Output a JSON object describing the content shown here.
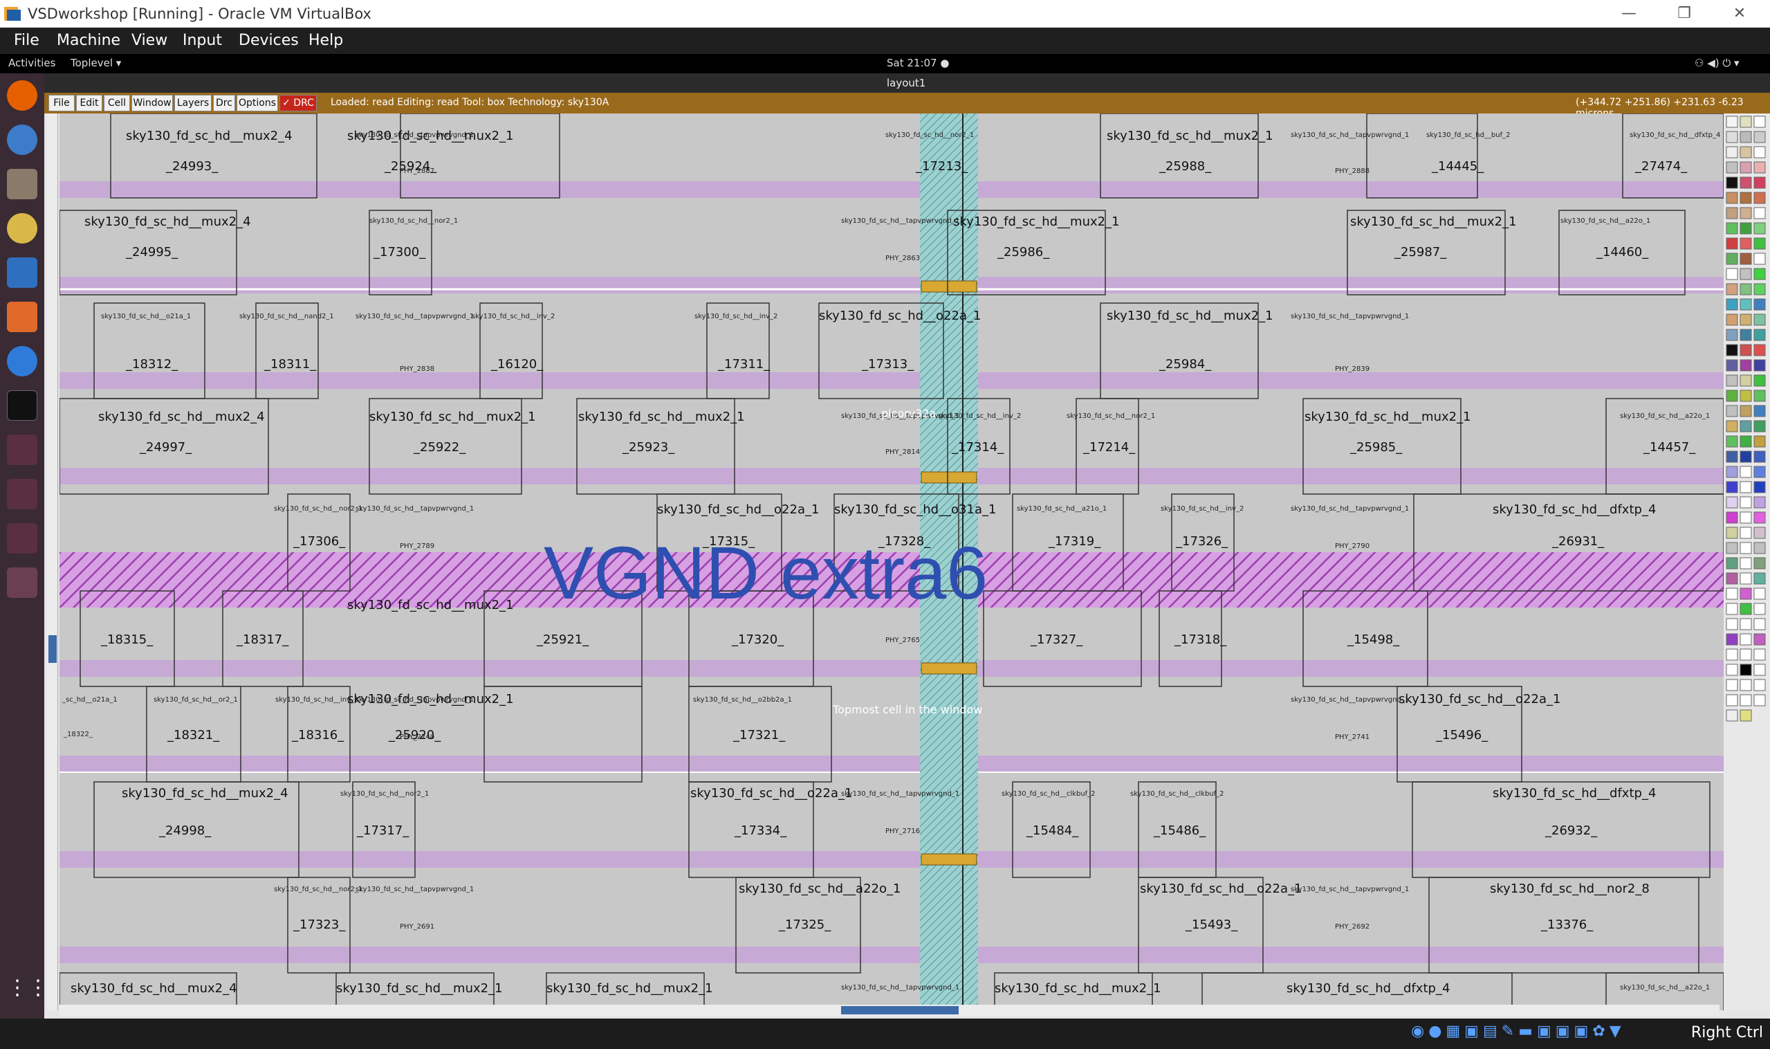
{
  "vbox": {
    "title": "VSDworkshop [Running] - Oracle VM VirtualBox",
    "menu": [
      "File",
      "Machine",
      "View",
      "Input",
      "Devices",
      "Help"
    ],
    "right_ctrl": "Right Ctrl"
  },
  "gnome": {
    "activities": "Activities",
    "toplevel": "Toplevel ▾",
    "clock": "Sat 21:07 ●"
  },
  "magic": {
    "window_title": "layout1",
    "buttons": [
      "File",
      "Edit",
      "Cell",
      "Window",
      "Layers",
      "Drc",
      "Options"
    ],
    "drc_label": "✓ DRC",
    "status_text": "Loaded: read  Editing: read  Tool: box   Technology: sky130A",
    "coords": "(+344.72 +251.86) +231.63 -6.23 microns"
  },
  "layout": {
    "big_label": "VGND extra6",
    "label_picorv": "picorv32a",
    "label_topmost": "Topmost cell in the window",
    "cells": [
      {
        "name": "sky130_fd_sc_hd__mux2_4",
        "id": "_24993_"
      },
      {
        "name": "sky130_fd_sc_hd__mux2_1",
        "id": "_25924_"
      },
      {
        "name": "sky130_fd_sc_hd__nor2_1",
        "id": "_17213_"
      },
      {
        "name": "sky130_fd_sc_hd__mux2_1",
        "id": "_25988_"
      },
      {
        "name": "sky130_fd_sc_hd__buf_2",
        "id": "_14445_"
      },
      {
        "name": "sky130_fd_sc_hd__dfxtp_4",
        "id": "_27474_"
      },
      {
        "name": "sky130_fd_sc_hd__mux2_4",
        "id": "_24995_"
      },
      {
        "name": "sky130_fd_sc_hd__nor2_1",
        "id": "_17300_"
      },
      {
        "name": "sky130_fd_sc_hd__mux2_1",
        "id": "_25986_"
      },
      {
        "name": "sky130_fd_sc_hd__mux2_1",
        "id": "_25987_"
      },
      {
        "name": "sky130_fd_sc_hd__a22o_1",
        "id": "_14460_"
      },
      {
        "name": "sky130_fd_sc_hd__o21a_1",
        "id": "_18312_"
      },
      {
        "name": "sky130_fd_sc_hd__nand2_1",
        "id": "_18311_"
      },
      {
        "name": "sky130_fd_sc_hd__inv_2",
        "id": "_16120_"
      },
      {
        "name": "sky130_fd_sc_hd__inv_2",
        "id": "_17311_"
      },
      {
        "name": "sky130_fd_sc_hd__o22a_1",
        "id": "_17313_"
      },
      {
        "name": "sky130_fd_sc_hd__mux2_1",
        "id": "_25984_"
      },
      {
        "name": "sky130_fd_sc_hd__mux2_4",
        "id": "_24997_"
      },
      {
        "name": "sky130_fd_sc_hd__mux2_1",
        "id": "_25922_"
      },
      {
        "name": "sky130_fd_sc_hd__mux2_1",
        "id": "_25923_"
      },
      {
        "name": "sky130_fd_sc_hd__inv_2",
        "id": "_17314_"
      },
      {
        "name": "sky130_fd_sc_hd__nor2_1",
        "id": "_17214_"
      },
      {
        "name": "sky130_fd_sc_hd__mux2_1",
        "id": "_25985_"
      },
      {
        "name": "sky130_fd_sc_hd__a22o_1",
        "id": "_14457_"
      },
      {
        "name": "sky130_fd_sc_hd__nor2_1",
        "id": "_17306_"
      },
      {
        "name": "sky130_fd_sc_hd__o22a_1",
        "id": "_17315_"
      },
      {
        "name": "sky130_fd_sc_hd__o31a_1",
        "id": "_17328_"
      },
      {
        "name": "sky130_fd_sc_hd__a21o_1",
        "id": "_17319_"
      },
      {
        "name": "sky130_fd_sc_hd__inv_2",
        "id": "_17326_"
      },
      {
        "name": "sky130_fd_sc_hd__dfxtp_4",
        "id": "_26931_"
      },
      {
        "name": "sky130_fd_sc_hd__o21a_1",
        "id": "_18315_"
      },
      {
        "name": "sky130_fd_sc_hd__a21o_1",
        "id": "_18317_"
      },
      {
        "name": "sky130_fd_sc_hd__mux2_1",
        "id": "_25921_"
      },
      {
        "name": "sky130_fd_sc_hd__o22a_1",
        "id": "_17320_"
      },
      {
        "name": "sky130_fd_sc_hd__o32a_1",
        "id": "_17327_"
      },
      {
        "name": "sky130_fd_sc_hd__o21a_1",
        "id": "_17318_"
      },
      {
        "name": "sky130_fd_sc_hd__o22a_1",
        "id": "_15498_"
      },
      {
        "name": "sky130_fd_sc_hd__or2_1",
        "id": "_18321_"
      },
      {
        "name": "sky130_fd_sc_hd__inv_2",
        "id": "_18316_"
      },
      {
        "name": "sky130_fd_sc_hd__mux2_1",
        "id": "_25920_"
      },
      {
        "name": "sky130_fd_sc_hd__o2bb2a_1",
        "id": "_17321_"
      },
      {
        "name": "sky130_fd_sc_hd__o22a_1",
        "id": "_15496_"
      },
      {
        "name": "sky130_fd_sc_hd__mux2_4",
        "id": "_24998_"
      },
      {
        "name": "sky130_fd_sc_hd__nor2_1",
        "id": "_17317_"
      },
      {
        "name": "sky130_fd_sc_hd__o22a_1",
        "id": "_17334_"
      },
      {
        "name": "sky130_fd_sc_hd__clkbuf_2",
        "id": "_15484_"
      },
      {
        "name": "sky130_fd_sc_hd__clkbuf_2",
        "id": "_15486_"
      },
      {
        "name": "sky130_fd_sc_hd__dfxtp_4",
        "id": "_26932_"
      },
      {
        "name": "sky130_fd_sc_hd__nor2_1",
        "id": "_17323_"
      },
      {
        "name": "sky130_fd_sc_hd__a22o_1",
        "id": "_17325_"
      },
      {
        "name": "sky130_fd_sc_hd__o22a_1",
        "id": "_15493_"
      },
      {
        "name": "sky130_fd_sc_hd__nor2_8",
        "id": "_13376_"
      },
      {
        "name": "sky130_fd_sc_hd__mux2_4",
        "id": ""
      },
      {
        "name": "sky130_fd_sc_hd__mux2_1",
        "id": ""
      },
      {
        "name": "sky130_fd_sc_hd__mux2_1",
        "id": ""
      },
      {
        "name": "sky130_fd_sc_hd__mux2_1",
        "id": ""
      },
      {
        "name": "sky130_fd_sc_hd__dfxtp_4",
        "id": ""
      },
      {
        "name": "sky130_fd_sc_hd__a22o_1",
        "id": ""
      }
    ],
    "tap_label": "sky130_fd_sc_hd__tapvpwrvgnd_1",
    "phy_labels": [
      "PHY_2887",
      "PHY_2888",
      "PHY_2863",
      "PHY_2838",
      "PHY_2839",
      "PHY_2814",
      "PHY_2789",
      "PHY_2790",
      "PHY_2765",
      "PHY_2740",
      "PHY_2741",
      "PHY_2716",
      "PHY_2691",
      "PHY_2692"
    ],
    "partial_labels": {
      "o21a": "_sc_hd__o21a_1",
      "id18322": "_18322_"
    }
  },
  "colors": {
    "rail": "#c7a9d6",
    "hatch": "#9b3fb0",
    "label_blue": "#2e4fb0",
    "magic_bar": "#9a6a1c"
  }
}
